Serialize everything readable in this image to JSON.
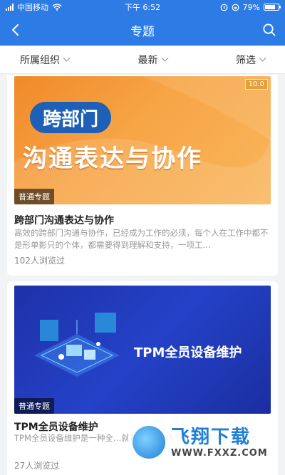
{
  "status_bar": {
    "carrier": "中国移动",
    "time": "下午 6:52",
    "battery": "79%",
    "battery_level": 0.79
  },
  "header": {
    "title": "专题"
  },
  "filters": [
    {
      "label": "所属组织"
    },
    {
      "label": "最新"
    },
    {
      "label": "筛选"
    }
  ],
  "cards": [
    {
      "score": "10.0",
      "cover_pill": "跨部门",
      "cover_headline": "沟通表达与协作",
      "badge": "普通专题",
      "title": "跨部门沟通表达与协作",
      "description": "高效的跨部门沟通与协作，已经成为工作的必须，每个人在工作中都不是形单影只的个体，都需要得到理解和支持，一项工...",
      "views": "102人浏览过"
    },
    {
      "cover_title": "TPM全员设备维护",
      "badge": "普通专题",
      "title": "TPM全员设备维护",
      "description": "TPM全员设备维护是一种全…就在\"生产维修\"及\"全员参与…",
      "views": "27人浏览过"
    }
  ],
  "watermark": {
    "cn": "飞翔下载",
    "en": "WWW.FXXZ.COM"
  },
  "colors": {
    "primary": "#2d7ce6",
    "card_orange": "#f7a546",
    "card_blue": "#2442c8"
  }
}
